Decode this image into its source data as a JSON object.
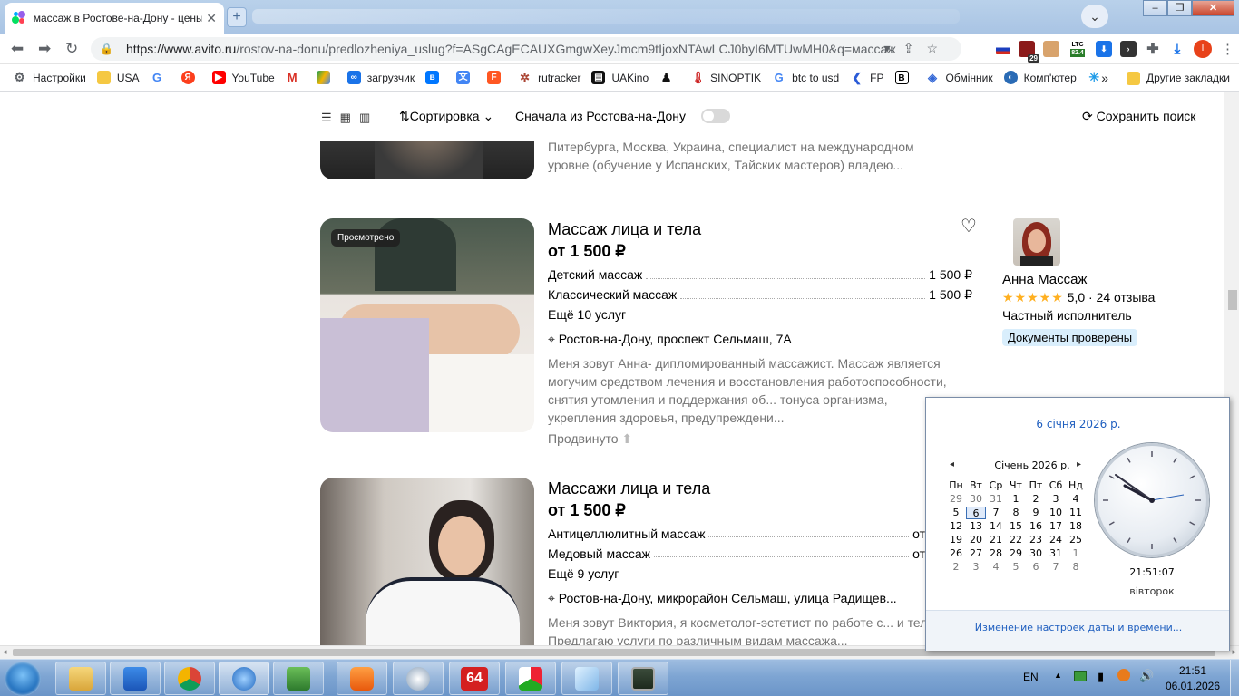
{
  "browser": {
    "tab_title": "массаж в Ростове-на-Дону - цены",
    "url_host": "https://www.avito.ru",
    "url_path": "/rostov-na-donu/predlozheniya_uslug?f=ASgCAgECAUXGmgwXeyJmcm9tIjoxNTAwLCJ0byI6MTUwMH0&q=массаж",
    "extensions": {
      "ltc_label": "LTC",
      "ltc_value": "82.4",
      "badge_29": "29",
      "profile_initial": "I"
    },
    "bookmarks": [
      "Настройки",
      "USA",
      "YouTube",
      "загрузчик",
      "rutracker",
      "UAKino",
      "SINOPTIK",
      "btc to usd",
      "FP",
      "Обмінник",
      "Комп'ютер"
    ],
    "bookmarks_other": "Другие закладки",
    "bookmarks_more": "»"
  },
  "filters": {
    "sort_label": "Сортировка",
    "rostov_first_label": "Сначала из Ростова-на-Дону",
    "save_search_label": "Сохранить поиск"
  },
  "prev_listing": {
    "desc": "Питербурга, Москва, Украина, специалист на международном уровне (обучение у Испанских, Тайских мастеров) владею..."
  },
  "listing1": {
    "viewed_badge": "Просмотрено",
    "title": "Массаж лица и тела",
    "price": "от 1 500 ₽",
    "services": [
      {
        "name": "Детский массаж",
        "price": "1 500 ₽"
      },
      {
        "name": "Классический массаж",
        "price": "1 500 ₽"
      }
    ],
    "more": "Ещё 10 услуг",
    "address": "Ростов-на-Дону, проспект Сельмаш, 7А",
    "desc": "Меня зовут Анна- дипломированный массажист. Массаж является могучим средством лечения и восстановления работоспособности, снятия утомления и поддержания об... тонуса организма, укрепления здоровья, предупреждени...",
    "promoted": "Продвинуто",
    "seller": {
      "name": "Анна Массаж",
      "stars": "★★★★★",
      "rating": "5,0 · 24 отзыва",
      "type": "Частный исполнитель",
      "docs": "Документы проверены"
    }
  },
  "listing2": {
    "title": "Массажи лица и тела",
    "price": "от 1 500 ₽",
    "services": [
      {
        "name": "Антицеллюлитный массаж",
        "price": "от"
      },
      {
        "name": "Медовый массаж",
        "price": "от"
      }
    ],
    "more": "Ещё 9 услуг",
    "address": "Ростов-на-Дону, микрорайон Сельмаш, улица Радищев...",
    "desc": "Меня зовут Виктория, я косметолог-эстетист по работе с... и телом. Предлагаю услуги по различным видам массажа..."
  },
  "calendar": {
    "full_date": "6 січня 2026 р.",
    "month": "Січень 2026 р.",
    "weekdays": [
      "Пн",
      "Вт",
      "Ср",
      "Чт",
      "Пт",
      "Сб",
      "Нд"
    ],
    "weeks": [
      [
        "29",
        "30",
        "31",
        "1",
        "2",
        "3",
        "4"
      ],
      [
        "5",
        "6",
        "7",
        "8",
        "9",
        "10",
        "11"
      ],
      [
        "12",
        "13",
        "14",
        "15",
        "16",
        "17",
        "18"
      ],
      [
        "19",
        "20",
        "21",
        "22",
        "23",
        "24",
        "25"
      ],
      [
        "26",
        "27",
        "28",
        "29",
        "30",
        "31",
        "1"
      ],
      [
        "2",
        "3",
        "4",
        "5",
        "6",
        "7",
        "8"
      ]
    ],
    "clock_time": "21:51:07",
    "clock_day": "вівторок",
    "settings_link": "Изменение настроек даты и времени..."
  },
  "taskbar": {
    "lang": "EN",
    "time": "21:51",
    "date": "06.01.2026",
    "app_64_label": "64"
  }
}
